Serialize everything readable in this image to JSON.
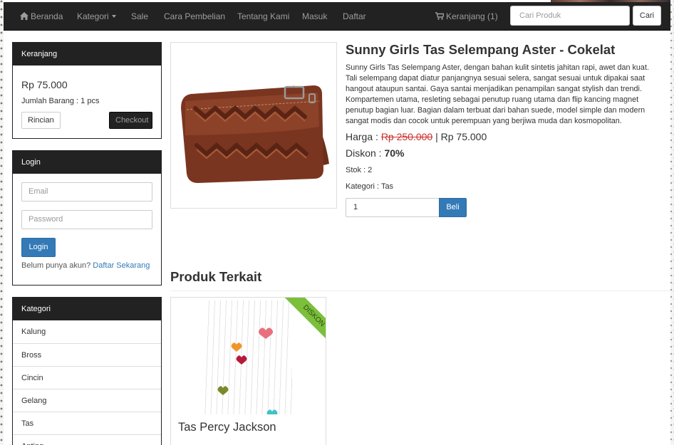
{
  "navbar": {
    "items": [
      {
        "label": "Beranda",
        "icon": "home-icon"
      },
      {
        "label": "Kategori",
        "icon": "chevron-down-icon"
      },
      {
        "label": "Sale"
      },
      {
        "label": "Cara Pembelian"
      },
      {
        "label": "Tentang Kami"
      },
      {
        "label": "Masuk"
      },
      {
        "label": "Daftar"
      }
    ],
    "cart_label": "Keranjang (1)",
    "search_placeholder": "Cari Produk",
    "search_button": "Cari"
  },
  "cart_panel": {
    "title": "Keranjang",
    "total": "Rp 75.000",
    "count": "Jumlah Barang : 1 pcs",
    "details_button": "Rincian",
    "checkout_button": "Checkout"
  },
  "login_panel": {
    "title": "Login",
    "email_placeholder": "Email",
    "password_placeholder": "Password",
    "login_button": "Login",
    "register_prompt": "Belum punya akun?",
    "register_link": "Daftar Sekarang"
  },
  "category_panel": {
    "title": "Kategori",
    "items": [
      "Kalung",
      "Bross",
      "Cincin",
      "Gelang",
      "Tas",
      "Anting"
    ]
  },
  "product": {
    "title": "Sunny Girls Tas Selempang Aster - Cokelat",
    "description": "Sunny Girls Tas Selempang Aster, dengan bahan kulit sintetis jahitan rapi, awet dan kuat. Tali selempang dapat diatur panjangnya sesuai selera, sangat sesuai untuk dipakai saat hangout ataupun santai. Gaya santai menjadikan penampilan sangat stylish dan trendi. Kompartemen utama, resleting sebagai penutup ruang utama dan flip kancing magnet penutup bagian luar. Bagian dalam terbuat dari bahan suede, model simple dan modern sangat modis dan cocok untuk perempuan yang berjiwa muda dan kosmopolitan.",
    "price_label": "Harga :",
    "price_old": "Rp 250.000",
    "price_separator": "|",
    "price_new": "Rp 75.000",
    "discount_label": "Diskon :",
    "discount_value": "70%",
    "stock": "Stok : 2",
    "category": "Kategori : Tas",
    "quantity_value": "1",
    "buy_button": "Beli"
  },
  "related": {
    "heading": "Produk Terkait",
    "items": [
      {
        "title": "Tas Percy Jackson",
        "badge": "DISKON"
      }
    ]
  },
  "colors": {
    "navbar": "#222222",
    "primary": "#337ab7",
    "strike_price": "#c9302c",
    "ribbon": "#7bbf3b"
  }
}
